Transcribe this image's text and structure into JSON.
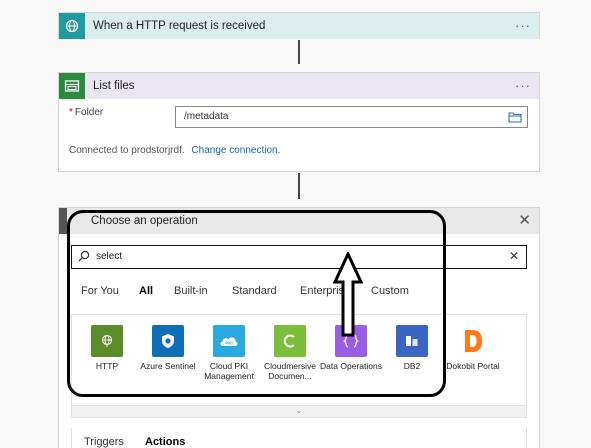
{
  "flow": {
    "step1": {
      "title": "When a HTTP request is received",
      "menu": "···"
    },
    "step2": {
      "title": "List files",
      "menu": "···",
      "folder_label": "Folder",
      "required_mark": "*",
      "folder_value": "/metadata",
      "connected_text": "Connected to prodstorjrdf.",
      "change_link": "Change connection."
    },
    "step3": {
      "title": "Choose an operation",
      "close": "✕",
      "search_value": "select",
      "search_clear": "✕",
      "tabs": [
        "For You",
        "All",
        "Built-in",
        "Standard",
        "Enterprise",
        "Custom"
      ],
      "active_tab": "All",
      "connectors": [
        {
          "name": "HTTP",
          "color": "#5b8c2a",
          "icon": "globe-icon"
        },
        {
          "name": "Azure Sentinel",
          "color": "#0f6fb6",
          "icon": "shield-icon"
        },
        {
          "name": "Cloud PKI Management",
          "color": "#2aa8e0",
          "icon": "cloud-icon"
        },
        {
          "name": "Cloudmersive Documen...",
          "color": "#7cbd3a",
          "icon": "c-logo-icon"
        },
        {
          "name": "Data Operations",
          "color": "#9b5de5",
          "icon": "braces-icon"
        },
        {
          "name": "DB2",
          "color": "#3b65c4",
          "icon": "database-icon"
        },
        {
          "name": "Dokobit Portal",
          "color": "#ff7a1a",
          "icon": "d-logo-icon"
        }
      ],
      "expand": "⌄",
      "bottom_tabs": [
        "Triggers",
        "Actions"
      ],
      "active_bottom_tab": "Actions"
    }
  },
  "colors": {
    "http_header": "#dcedf0",
    "list_header": "#e9e5f1",
    "link": "#1565c0"
  }
}
